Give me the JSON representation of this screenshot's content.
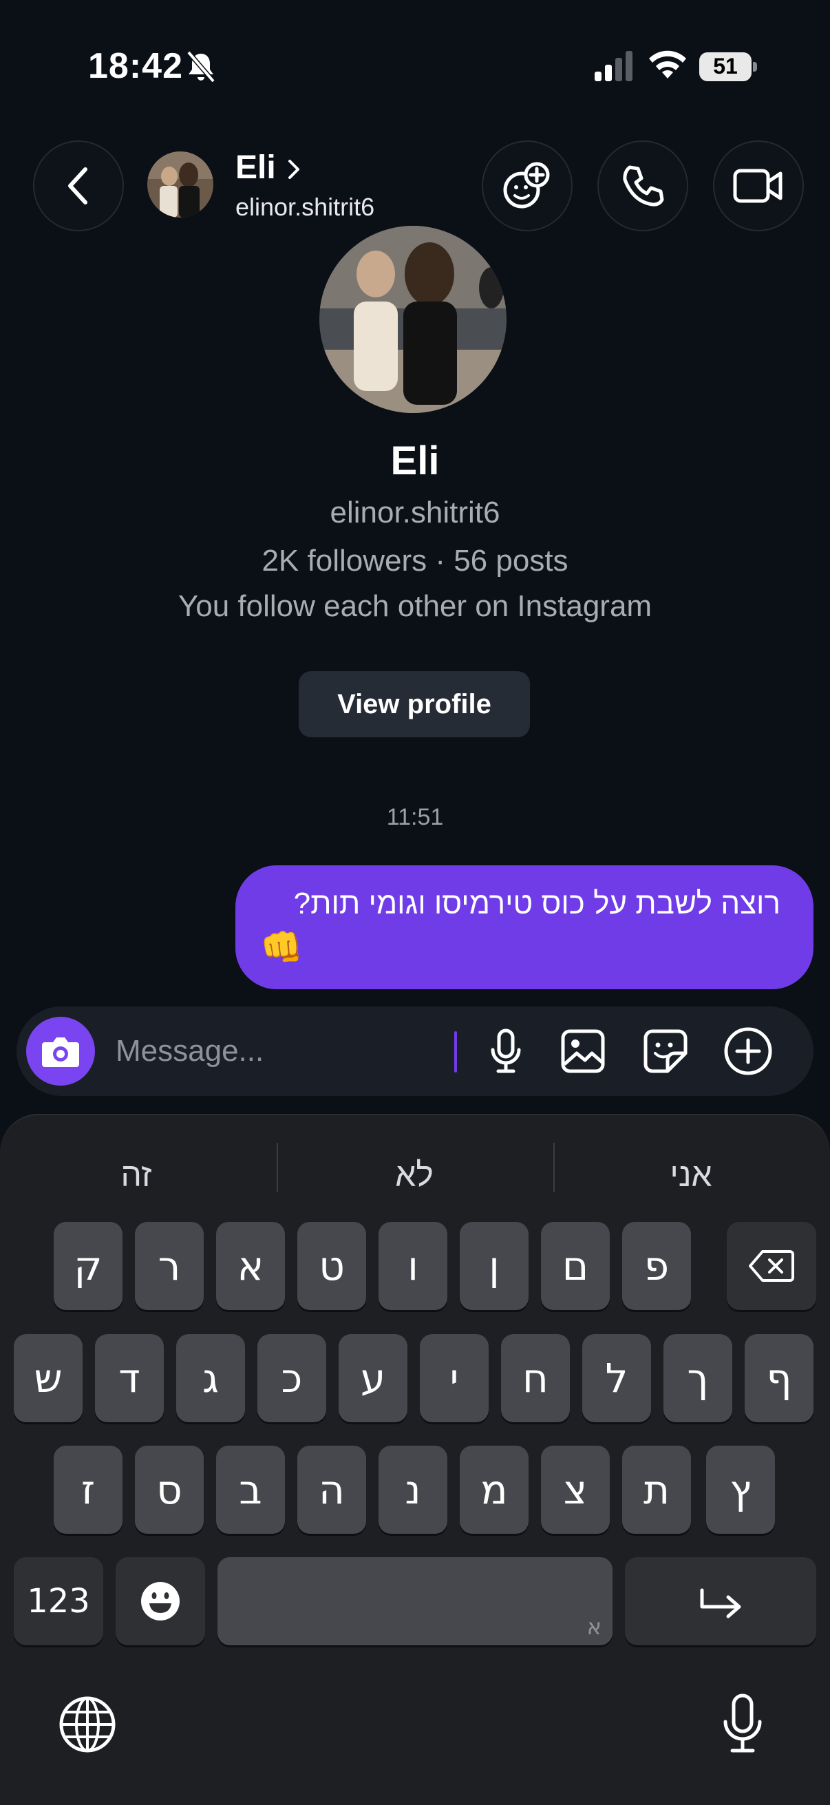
{
  "status_bar": {
    "time": "18:42",
    "battery": "51"
  },
  "header": {
    "name": "Eli",
    "username": "elinor.shitrit6"
  },
  "profile": {
    "name": "Eli",
    "username": "elinor.shitrit6",
    "stats": "2K followers · 56 posts",
    "mutual": "You follow each other on Instagram",
    "view_profile_label": "View profile"
  },
  "chat": {
    "timestamp": "11:51",
    "messages": [
      {
        "text": "רוצה לשבת על כוס טירמיסו וגומי תות?",
        "emoji": "👊"
      }
    ]
  },
  "composer": {
    "placeholder": "Message..."
  },
  "keyboard": {
    "suggestions": [
      "זה",
      "לא",
      "אני"
    ],
    "row1": [
      "ק",
      "ר",
      "א",
      "ט",
      "ו",
      "ן",
      "ם",
      "פ"
    ],
    "row2": [
      "ש",
      "ד",
      "ג",
      "כ",
      "ע",
      "י",
      "ח",
      "ל",
      "ך",
      "ף"
    ],
    "row3": [
      "ז",
      "ס",
      "ב",
      "ה",
      "נ",
      "מ",
      "צ",
      "ת",
      "ץ"
    ],
    "numbers_label": "123",
    "space_hint": "א"
  }
}
